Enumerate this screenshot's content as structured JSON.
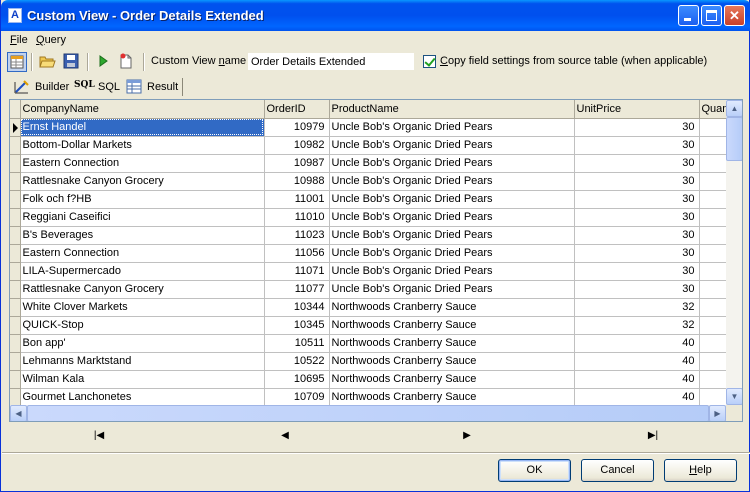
{
  "window": {
    "title": "Custom View - Order Details Extended"
  },
  "menu": [
    {
      "label": "File",
      "mnemonic": "F",
      "rest": "ile"
    },
    {
      "label": "Query",
      "mnemonic": "Q",
      "rest": "uery"
    }
  ],
  "toolbar": {
    "custom_view_label_pre": "Custom View ",
    "custom_view_label_mn": "n",
    "custom_view_label_post": "ame",
    "custom_view_name": "Order Details Extended",
    "copy_settings_checked": true,
    "copy_settings_pre": "",
    "copy_settings_mn": "C",
    "copy_settings_post": "opy field settings from source table (when applicable)"
  },
  "tabs": [
    {
      "label": "Builder",
      "icon": "builder-icon"
    },
    {
      "label": "SQL",
      "icon": "sql-icon",
      "icon_text": "SQL"
    },
    {
      "label": "Result",
      "icon": "result-grid-icon"
    }
  ],
  "grid": {
    "columns": [
      "CompanyName",
      "OrderID",
      "ProductName",
      "UnitPrice",
      "Quan"
    ],
    "rows": [
      [
        "Ernst Handel",
        "10979",
        "Uncle Bob's Organic Dried Pears",
        "30",
        ""
      ],
      [
        "Bottom-Dollar Markets",
        "10982",
        "Uncle Bob's Organic Dried Pears",
        "30",
        ""
      ],
      [
        "Eastern Connection",
        "10987",
        "Uncle Bob's Organic Dried Pears",
        "30",
        ""
      ],
      [
        "Rattlesnake Canyon Grocery",
        "10988",
        "Uncle Bob's Organic Dried Pears",
        "30",
        ""
      ],
      [
        "Folk och f?HB",
        "11001",
        "Uncle Bob's Organic Dried Pears",
        "30",
        ""
      ],
      [
        "Reggiani Caseifici",
        "11010",
        "Uncle Bob's Organic Dried Pears",
        "30",
        ""
      ],
      [
        "B's Beverages",
        "11023",
        "Uncle Bob's Organic Dried Pears",
        "30",
        ""
      ],
      [
        "Eastern Connection",
        "11056",
        "Uncle Bob's Organic Dried Pears",
        "30",
        ""
      ],
      [
        "LILA-Supermercado",
        "11071",
        "Uncle Bob's Organic Dried Pears",
        "30",
        ""
      ],
      [
        "Rattlesnake Canyon Grocery",
        "11077",
        "Uncle Bob's Organic Dried Pears",
        "30",
        ""
      ],
      [
        "White Clover Markets",
        "10344",
        "Northwoods Cranberry Sauce",
        "32",
        ""
      ],
      [
        "QUICK-Stop",
        "10345",
        "Northwoods Cranberry Sauce",
        "32",
        ""
      ],
      [
        "Bon app'",
        "10511",
        "Northwoods Cranberry Sauce",
        "40",
        ""
      ],
      [
        "Lehmanns Marktstand",
        "10522",
        "Northwoods Cranberry Sauce",
        "40",
        ""
      ],
      [
        "Wilman Kala",
        "10695",
        "Northwoods Cranberry Sauce",
        "40",
        ""
      ],
      [
        "Gourmet Lanchonetes",
        "10709",
        "Northwoods Cranberry Sauce",
        "40",
        ""
      ]
    ]
  },
  "navigation": {
    "first": "|◀",
    "prev": "◀",
    "next": "▶",
    "last": "▶|"
  },
  "buttons": {
    "ok": "OK",
    "cancel": "Cancel",
    "help_mn": "H",
    "help_rest": "elp"
  },
  "colors": {
    "title_bar": "#0053ee",
    "selection": "#316ac5",
    "dialog_face": "#ece9d8"
  }
}
